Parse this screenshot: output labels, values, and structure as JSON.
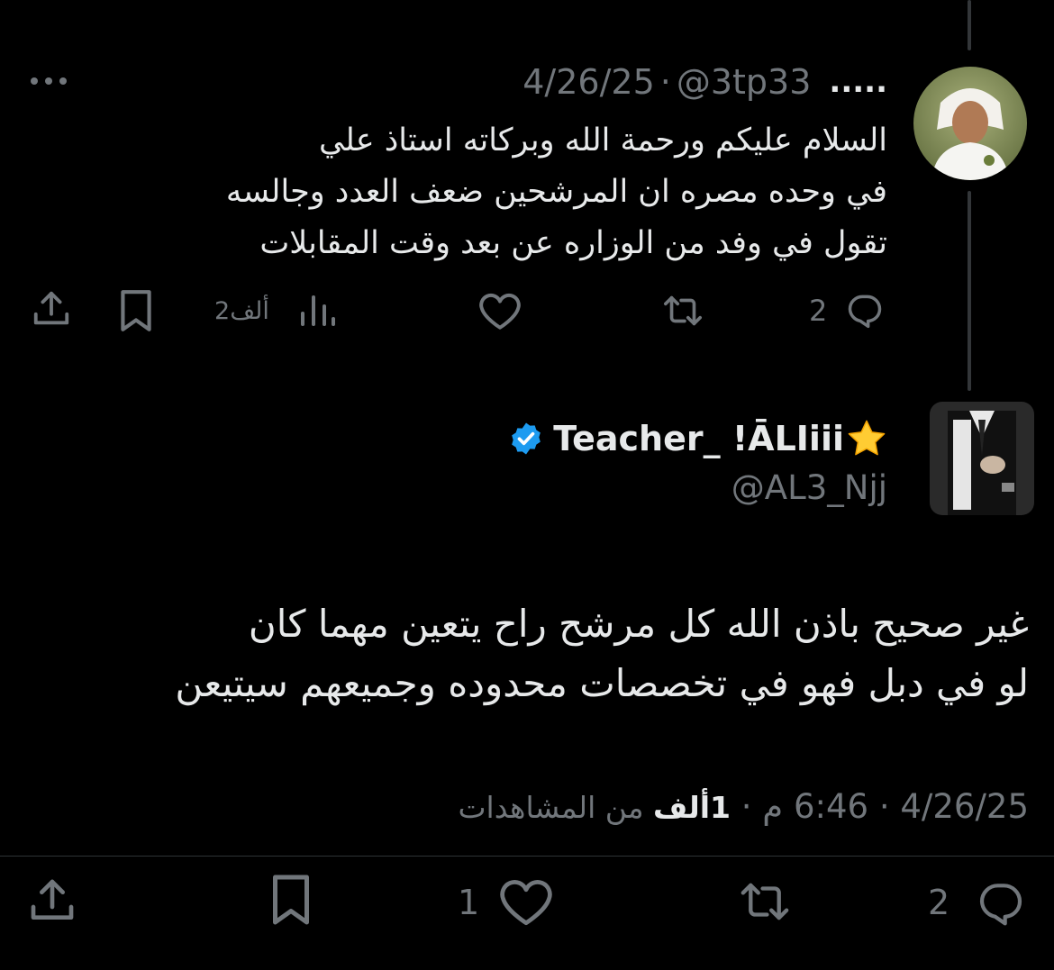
{
  "parent_tweet": {
    "display_name": ".....",
    "handle": "@3tp33",
    "separator": "·",
    "date": "4/26/25",
    "text_lines": [
      "السلام عليكم ورحمة الله وبركاته استاذ علي",
      "في وحده مصره ان المرشحين ضعف العدد وجالسه",
      "تقول في وفد من الوزاره عن بعد وقت المقابلات"
    ],
    "replies": "2",
    "likes": "",
    "views": "2ألف"
  },
  "main_tweet": {
    "display_name": "Teacher_ !ĀLIiii",
    "name_emoji": "⭐",
    "handle": "@AL3_Njj",
    "text_lines": [
      "غير صحيح باذن الله كل مرشح راح يتعين مهما كان",
      "لو في دبل فهو في تخصصات محدوده وجميعهم سيتيعن"
    ],
    "meta": {
      "date": "4/26/25",
      "sep1": " · ",
      "time": "6:46 م",
      "sep2": " · ",
      "views_count": "1ألف",
      "views_label": " من المشاهدات"
    },
    "replies": "2",
    "likes": "1"
  },
  "colors": {
    "background": "#000000",
    "text": "#e7e9ea",
    "secondary": "#71767b",
    "verified": "#1d9bf0",
    "thread_line": "#333639"
  },
  "icons": [
    "more-icon",
    "reply-icon",
    "retweet-icon",
    "like-icon",
    "views-icon",
    "bookmark-icon",
    "share-icon",
    "verified-badge-icon",
    "star-emoji"
  ]
}
